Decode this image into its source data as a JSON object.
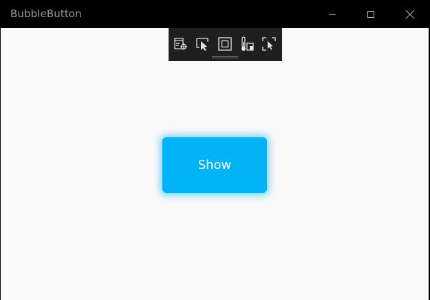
{
  "window": {
    "title": "BubbleButton"
  },
  "content": {
    "show_button_label": "Show"
  },
  "debug_toolbar": {
    "tools": [
      "live-visual-tree-icon",
      "select-element-icon",
      "display-layout-adorners-icon",
      "track-focus-icon",
      "display-ui-selection-icon"
    ]
  },
  "colors": {
    "accent": "#00b2f6",
    "client_background": "#f9f9f9",
    "titlebar": "#000000",
    "toolbar": "#1f1f1f"
  }
}
